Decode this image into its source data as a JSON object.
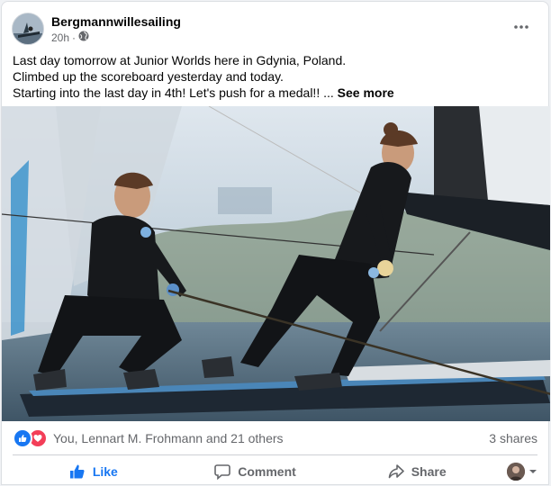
{
  "post": {
    "page_name": "Bergmannwillesailing",
    "time": "20h",
    "separator": "·",
    "audience_icon": "globe-icon",
    "lines": [
      "Last day tomorrow at Junior Worlds here in Gdynia, Poland.",
      "Climbed up the scoreboard yesterday and today.",
      "Starting into the last day in 4th! Let's push for a medal!! ..."
    ],
    "see_more": "See more"
  },
  "reactions": {
    "icons": [
      "like-icon",
      "love-icon"
    ],
    "summary": "You, Lennart M. Frohmann and 21 others",
    "shares": "3 shares"
  },
  "actions": {
    "like": "Like",
    "comment": "Comment",
    "share": "Share"
  },
  "colors": {
    "accent": "#1877f2",
    "love": "#f33e58",
    "muted_text": "#65676b",
    "divider": "#ced0d4"
  }
}
